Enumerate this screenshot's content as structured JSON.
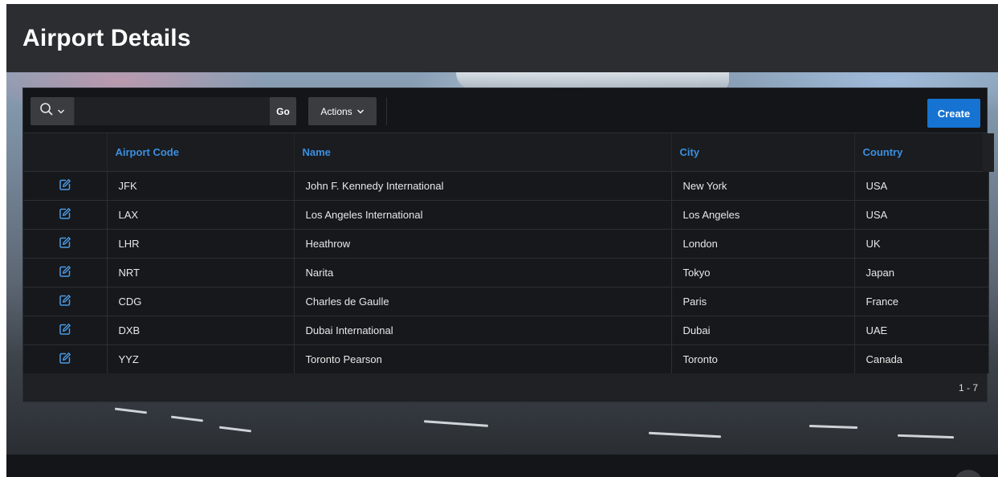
{
  "page": {
    "title": "Airport Details"
  },
  "toolbar": {
    "search_icon": "search-icon",
    "search_value": "",
    "search_placeholder": "",
    "go_label": "Go",
    "actions_label": "Actions",
    "create_label": "Create"
  },
  "table": {
    "columns": [
      "",
      "Airport Code",
      "Name",
      "City",
      "Country"
    ],
    "rows": [
      {
        "code": "JFK",
        "name": "John F. Kennedy International",
        "city": "New York",
        "country": "USA"
      },
      {
        "code": "LAX",
        "name": "Los Angeles International",
        "city": "Los Angeles",
        "country": "USA"
      },
      {
        "code": "LHR",
        "name": "Heathrow",
        "city": "London",
        "country": "UK"
      },
      {
        "code": "NRT",
        "name": "Narita",
        "city": "Tokyo",
        "country": "Japan"
      },
      {
        "code": "CDG",
        "name": "Charles de Gaulle",
        "city": "Paris",
        "country": "France"
      },
      {
        "code": "DXB",
        "name": "Dubai International",
        "city": "Dubai",
        "country": "UAE"
      },
      {
        "code": "YYZ",
        "name": "Toronto Pearson",
        "city": "Toronto",
        "country": "Canada"
      }
    ],
    "edit_icon": "edit-icon"
  },
  "pagination": {
    "range": "1 - 7"
  },
  "colors": {
    "accent": "#1673d2",
    "header_text": "#3b8fe0",
    "panel_bg": "#1f2124"
  }
}
